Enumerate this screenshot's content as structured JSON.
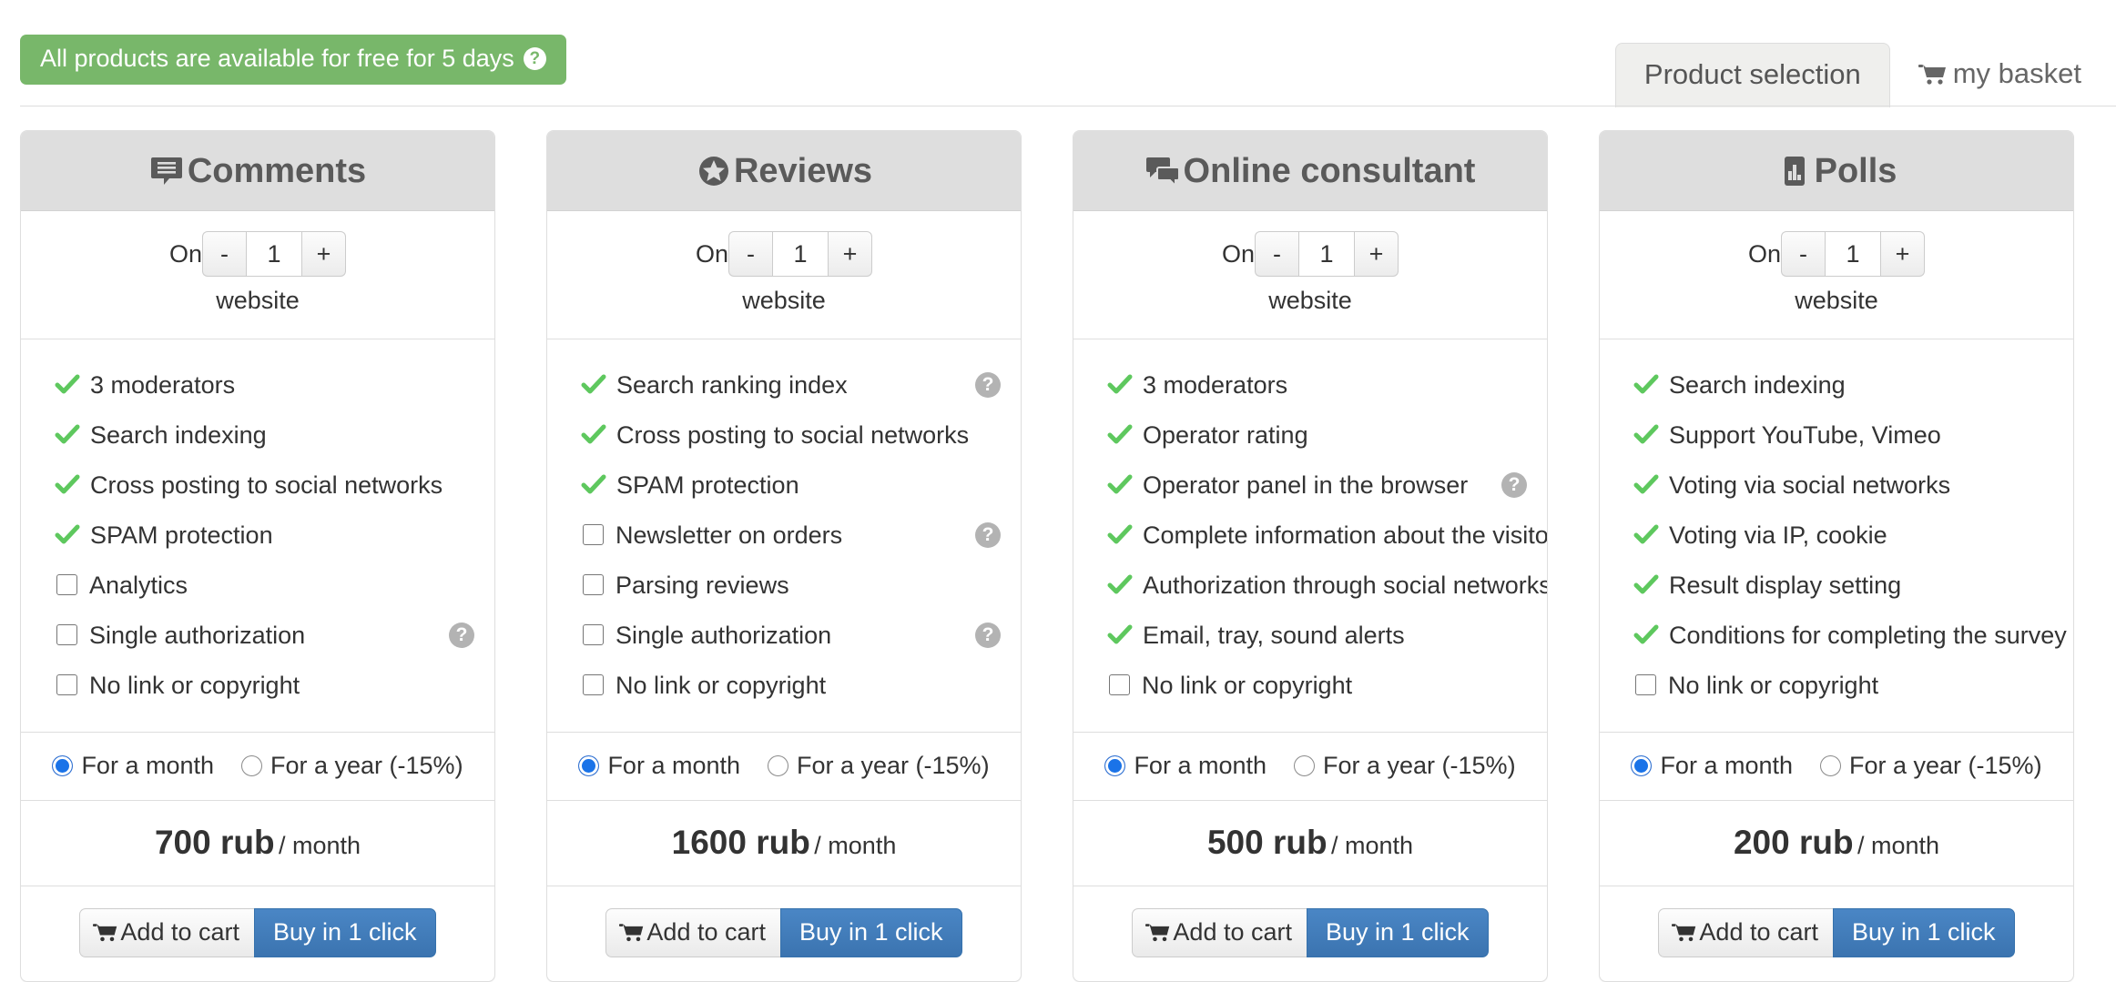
{
  "banner": {
    "text": "All products are available for free for 5 days",
    "help_icon": "question-circle-icon",
    "color": "#78b76a"
  },
  "tabs": [
    {
      "label": "Product selection",
      "active": true,
      "icon": ""
    },
    {
      "label": "my basket",
      "active": false,
      "icon": "shopping-cart-icon"
    }
  ],
  "common": {
    "qty_prefix": "On",
    "qty_suffix": "website",
    "minus": "-",
    "plus": "+",
    "qty_value": "1",
    "period_month": "For a month",
    "period_year": "For a year (-15%)",
    "price_per": "/ month",
    "add_to_cart": "Add to cart",
    "buy_one_click": "Buy in 1 click",
    "help_glyph": "?",
    "accent_blue": "#3b74b0",
    "check_green": "#5ec85e",
    "radio_blue": "#1a73e8"
  },
  "cards": [
    {
      "title": "Comments",
      "icon": "comment-lines-icon",
      "qty": "1",
      "features": [
        {
          "label": "3 moderators",
          "type": "check",
          "help": false
        },
        {
          "label": "Search indexing",
          "type": "check",
          "help": false
        },
        {
          "label": "Cross posting to social networks",
          "type": "check",
          "help": false
        },
        {
          "label": "SPAM protection",
          "type": "check",
          "help": false
        },
        {
          "label": "Analytics",
          "type": "checkbox",
          "help": false
        },
        {
          "label": "Single authorization",
          "type": "checkbox",
          "help": true
        },
        {
          "label": "No link or copyright",
          "type": "checkbox",
          "help": false
        }
      ],
      "period_selected": "month",
      "price": "700 rub"
    },
    {
      "title": "Reviews",
      "icon": "star-circle-icon",
      "qty": "1",
      "features": [
        {
          "label": "Search ranking index",
          "type": "check",
          "help": true
        },
        {
          "label": "Cross posting to social networks",
          "type": "check",
          "help": false
        },
        {
          "label": "SPAM protection",
          "type": "check",
          "help": false
        },
        {
          "label": "Newsletter on orders",
          "type": "checkbox",
          "help": true
        },
        {
          "label": "Parsing reviews",
          "type": "checkbox",
          "help": false
        },
        {
          "label": "Single authorization",
          "type": "checkbox",
          "help": true
        },
        {
          "label": "No link or copyright",
          "type": "checkbox",
          "help": false
        }
      ],
      "period_selected": "month",
      "price": "1600 rub"
    },
    {
      "title": "Online consultant",
      "icon": "comments-double-icon",
      "qty": "1",
      "features": [
        {
          "label": "3 moderators",
          "type": "check",
          "help": false
        },
        {
          "label": "Operator rating",
          "type": "check",
          "help": false
        },
        {
          "label": "Operator panel in the browser",
          "type": "check",
          "help": true
        },
        {
          "label": "Complete information about the visitor",
          "type": "check",
          "help": false
        },
        {
          "label": "Authorization through social networks",
          "type": "check",
          "help": false
        },
        {
          "label": "Email, tray, sound alerts",
          "type": "check",
          "help": false
        },
        {
          "label": "No link or copyright",
          "type": "checkbox",
          "help": false
        }
      ],
      "period_selected": "month",
      "price": "500 rub"
    },
    {
      "title": "Polls",
      "icon": "bar-chart-icon",
      "qty": "1",
      "features": [
        {
          "label": "Search indexing",
          "type": "check",
          "help": false
        },
        {
          "label": "Support YouTube, Vimeo",
          "type": "check",
          "help": false
        },
        {
          "label": "Voting via social networks",
          "type": "check",
          "help": false
        },
        {
          "label": "Voting via IP, cookie",
          "type": "check",
          "help": false
        },
        {
          "label": "Result display setting",
          "type": "check",
          "help": false
        },
        {
          "label": "Conditions for completing the survey",
          "type": "check",
          "help": false
        },
        {
          "label": "No link or copyright",
          "type": "checkbox",
          "help": false
        }
      ],
      "period_selected": "month",
      "price": "200 rub"
    }
  ]
}
